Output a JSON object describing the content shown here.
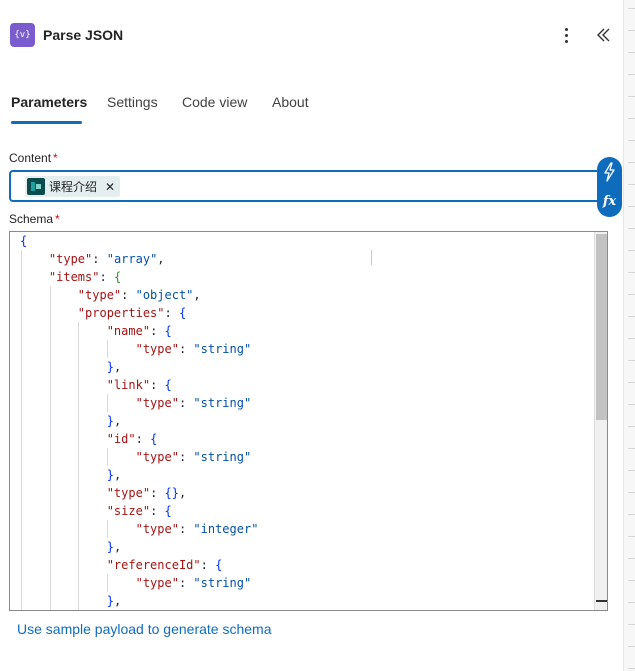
{
  "header": {
    "icon_text": "{v}",
    "title": "Parse JSON"
  },
  "tabs": [
    {
      "label": "Parameters",
      "active": true
    },
    {
      "label": "Settings",
      "active": false
    },
    {
      "label": "Code view",
      "active": false
    },
    {
      "label": "About",
      "active": false
    }
  ],
  "content_field": {
    "label": "Content",
    "required_mark": "*",
    "token": {
      "label": "课程介绍",
      "remove_glyph": "✕",
      "icon": "dataverse-table-icon"
    }
  },
  "schema_field": {
    "label": "Schema",
    "required_mark": "*",
    "code_lines": [
      "{",
      "    \"type\": \"array\",",
      "    \"items\": {",
      "        \"type\": \"object\",",
      "        \"properties\": {",
      "            \"name\": {",
      "                \"type\": \"string\"",
      "            },",
      "            \"link\": {",
      "                \"type\": \"string\"",
      "            },",
      "            \"id\": {",
      "                \"type\": \"string\"",
      "            },",
      "            \"type\": {},",
      "            \"size\": {",
      "                \"type\": \"integer\"",
      "            },",
      "            \"referenceId\": {",
      "                \"type\": \"string\"",
      "            },"
    ]
  },
  "side_tools": {
    "dynamic_content_icon": "lightning-icon",
    "expression_label": "fx"
  },
  "sample_payload_link": "Use sample payload to generate schema",
  "colors": {
    "accent": "#0f6cbd",
    "app_icon": "#7a5ccf",
    "required": "#c50f1f"
  }
}
